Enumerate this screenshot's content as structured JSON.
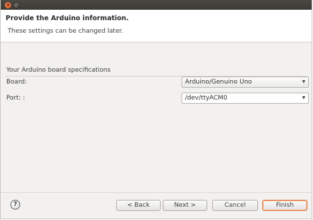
{
  "header": {
    "title": "Provide the Arduino information.",
    "description": "These settings can be changed later."
  },
  "board_specs": {
    "group_label": "Your Arduino board specifications",
    "board_label": "Board:",
    "board_value": "Arduino/Genuino Uno",
    "port_label": "Port: :",
    "port_value": "/dev/ttyACM0"
  },
  "buttons": {
    "back": "< Back",
    "next": "Next >",
    "cancel": "Cancel",
    "finish": "Finish"
  },
  "icons": {
    "close": "close-icon",
    "minimize": "minimize-icon",
    "help": "help-icon",
    "dropdown": "chevron-down-icon"
  },
  "colors": {
    "titlebar": "#3b3a36",
    "close_button": "#df4a16",
    "default_button_border": "#e0743a"
  }
}
